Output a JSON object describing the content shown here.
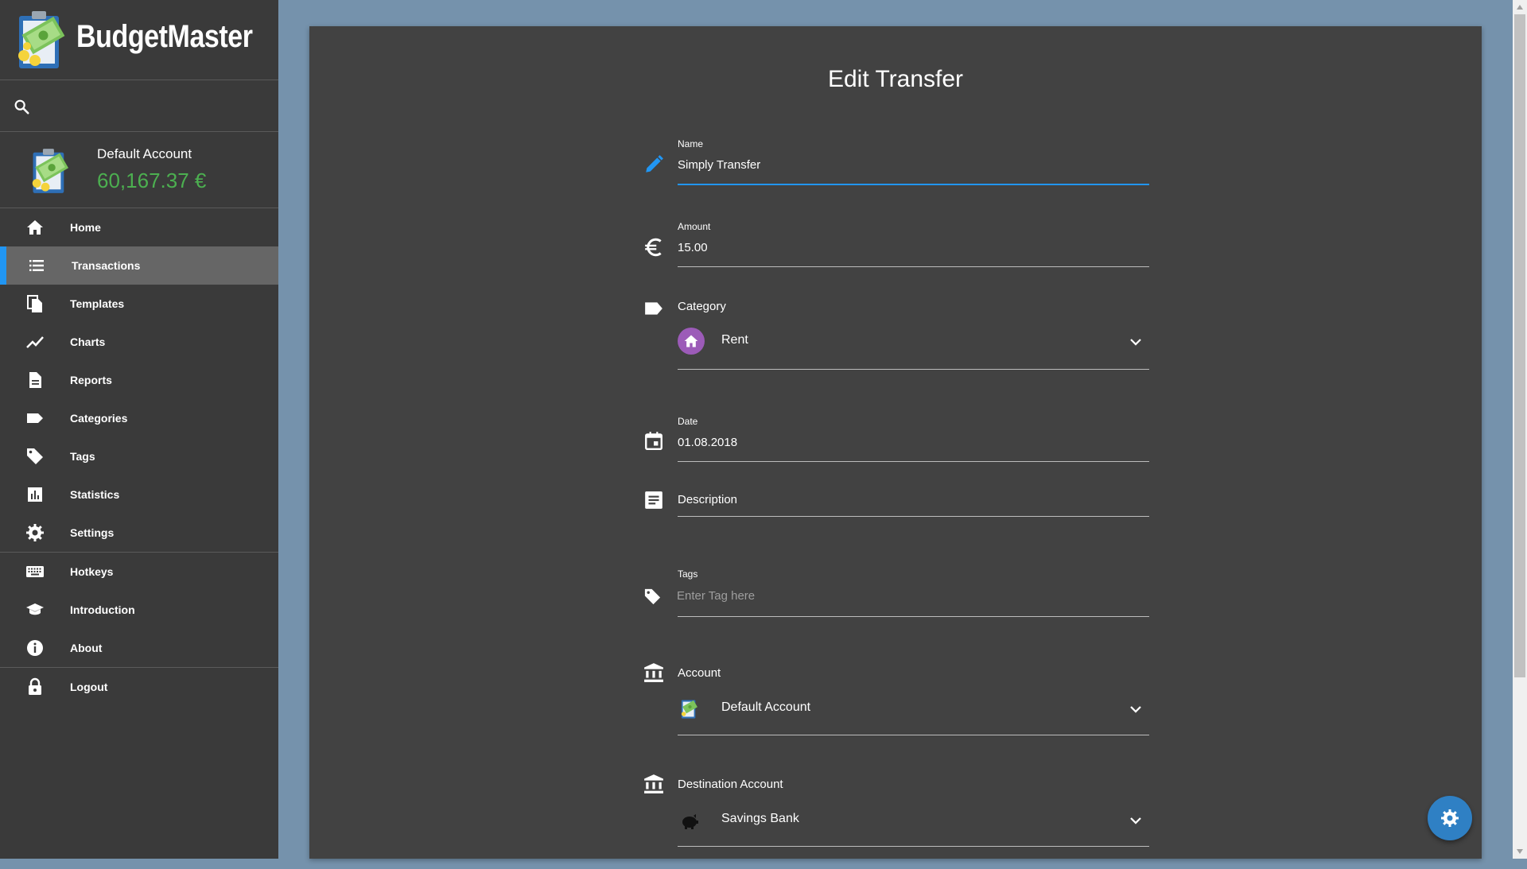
{
  "app": {
    "name": "BudgetMaster"
  },
  "search": {
    "placeholder": ""
  },
  "account": {
    "name": "Default Account",
    "balance": "60,167.37 €"
  },
  "nav": {
    "group1": [
      {
        "label": "Home",
        "icon": "home-icon"
      },
      {
        "label": "Transactions",
        "icon": "list-icon",
        "active": true
      },
      {
        "label": "Templates",
        "icon": "copy-icon"
      },
      {
        "label": "Charts",
        "icon": "trending-up-icon"
      },
      {
        "label": "Reports",
        "icon": "document-icon"
      },
      {
        "label": "Categories",
        "icon": "label-icon"
      },
      {
        "label": "Tags",
        "icon": "tag-icon"
      },
      {
        "label": "Statistics",
        "icon": "bar-chart-icon"
      },
      {
        "label": "Settings",
        "icon": "gear-icon"
      }
    ],
    "group2": [
      {
        "label": "Hotkeys",
        "icon": "keyboard-icon"
      },
      {
        "label": "Introduction",
        "icon": "graduation-cap-icon"
      },
      {
        "label": "About",
        "icon": "info-icon"
      }
    ],
    "group3": [
      {
        "label": "Logout",
        "icon": "lock-icon"
      }
    ]
  },
  "form": {
    "title": "Edit Transfer",
    "name": {
      "label": "Name",
      "value": "Simply Transfer"
    },
    "amount": {
      "label": "Amount",
      "value": "15.00"
    },
    "category": {
      "label": "Category",
      "value": "Rent",
      "color": "#9c5bb8"
    },
    "date": {
      "label": "Date",
      "value": "01.08.2018"
    },
    "description": {
      "label": "Description",
      "value": ""
    },
    "tags": {
      "label": "Tags",
      "placeholder": "Enter Tag here"
    },
    "account": {
      "label": "Account",
      "value": "Default Account"
    },
    "destination_account": {
      "label": "Destination Account",
      "value": "Savings Bank"
    }
  },
  "colors": {
    "sidebar_bg": "#3a3a3a",
    "main_bg": "#424242",
    "page_bg": "#7592ac",
    "accent": "#2196f3",
    "balance": "#4caf50"
  }
}
